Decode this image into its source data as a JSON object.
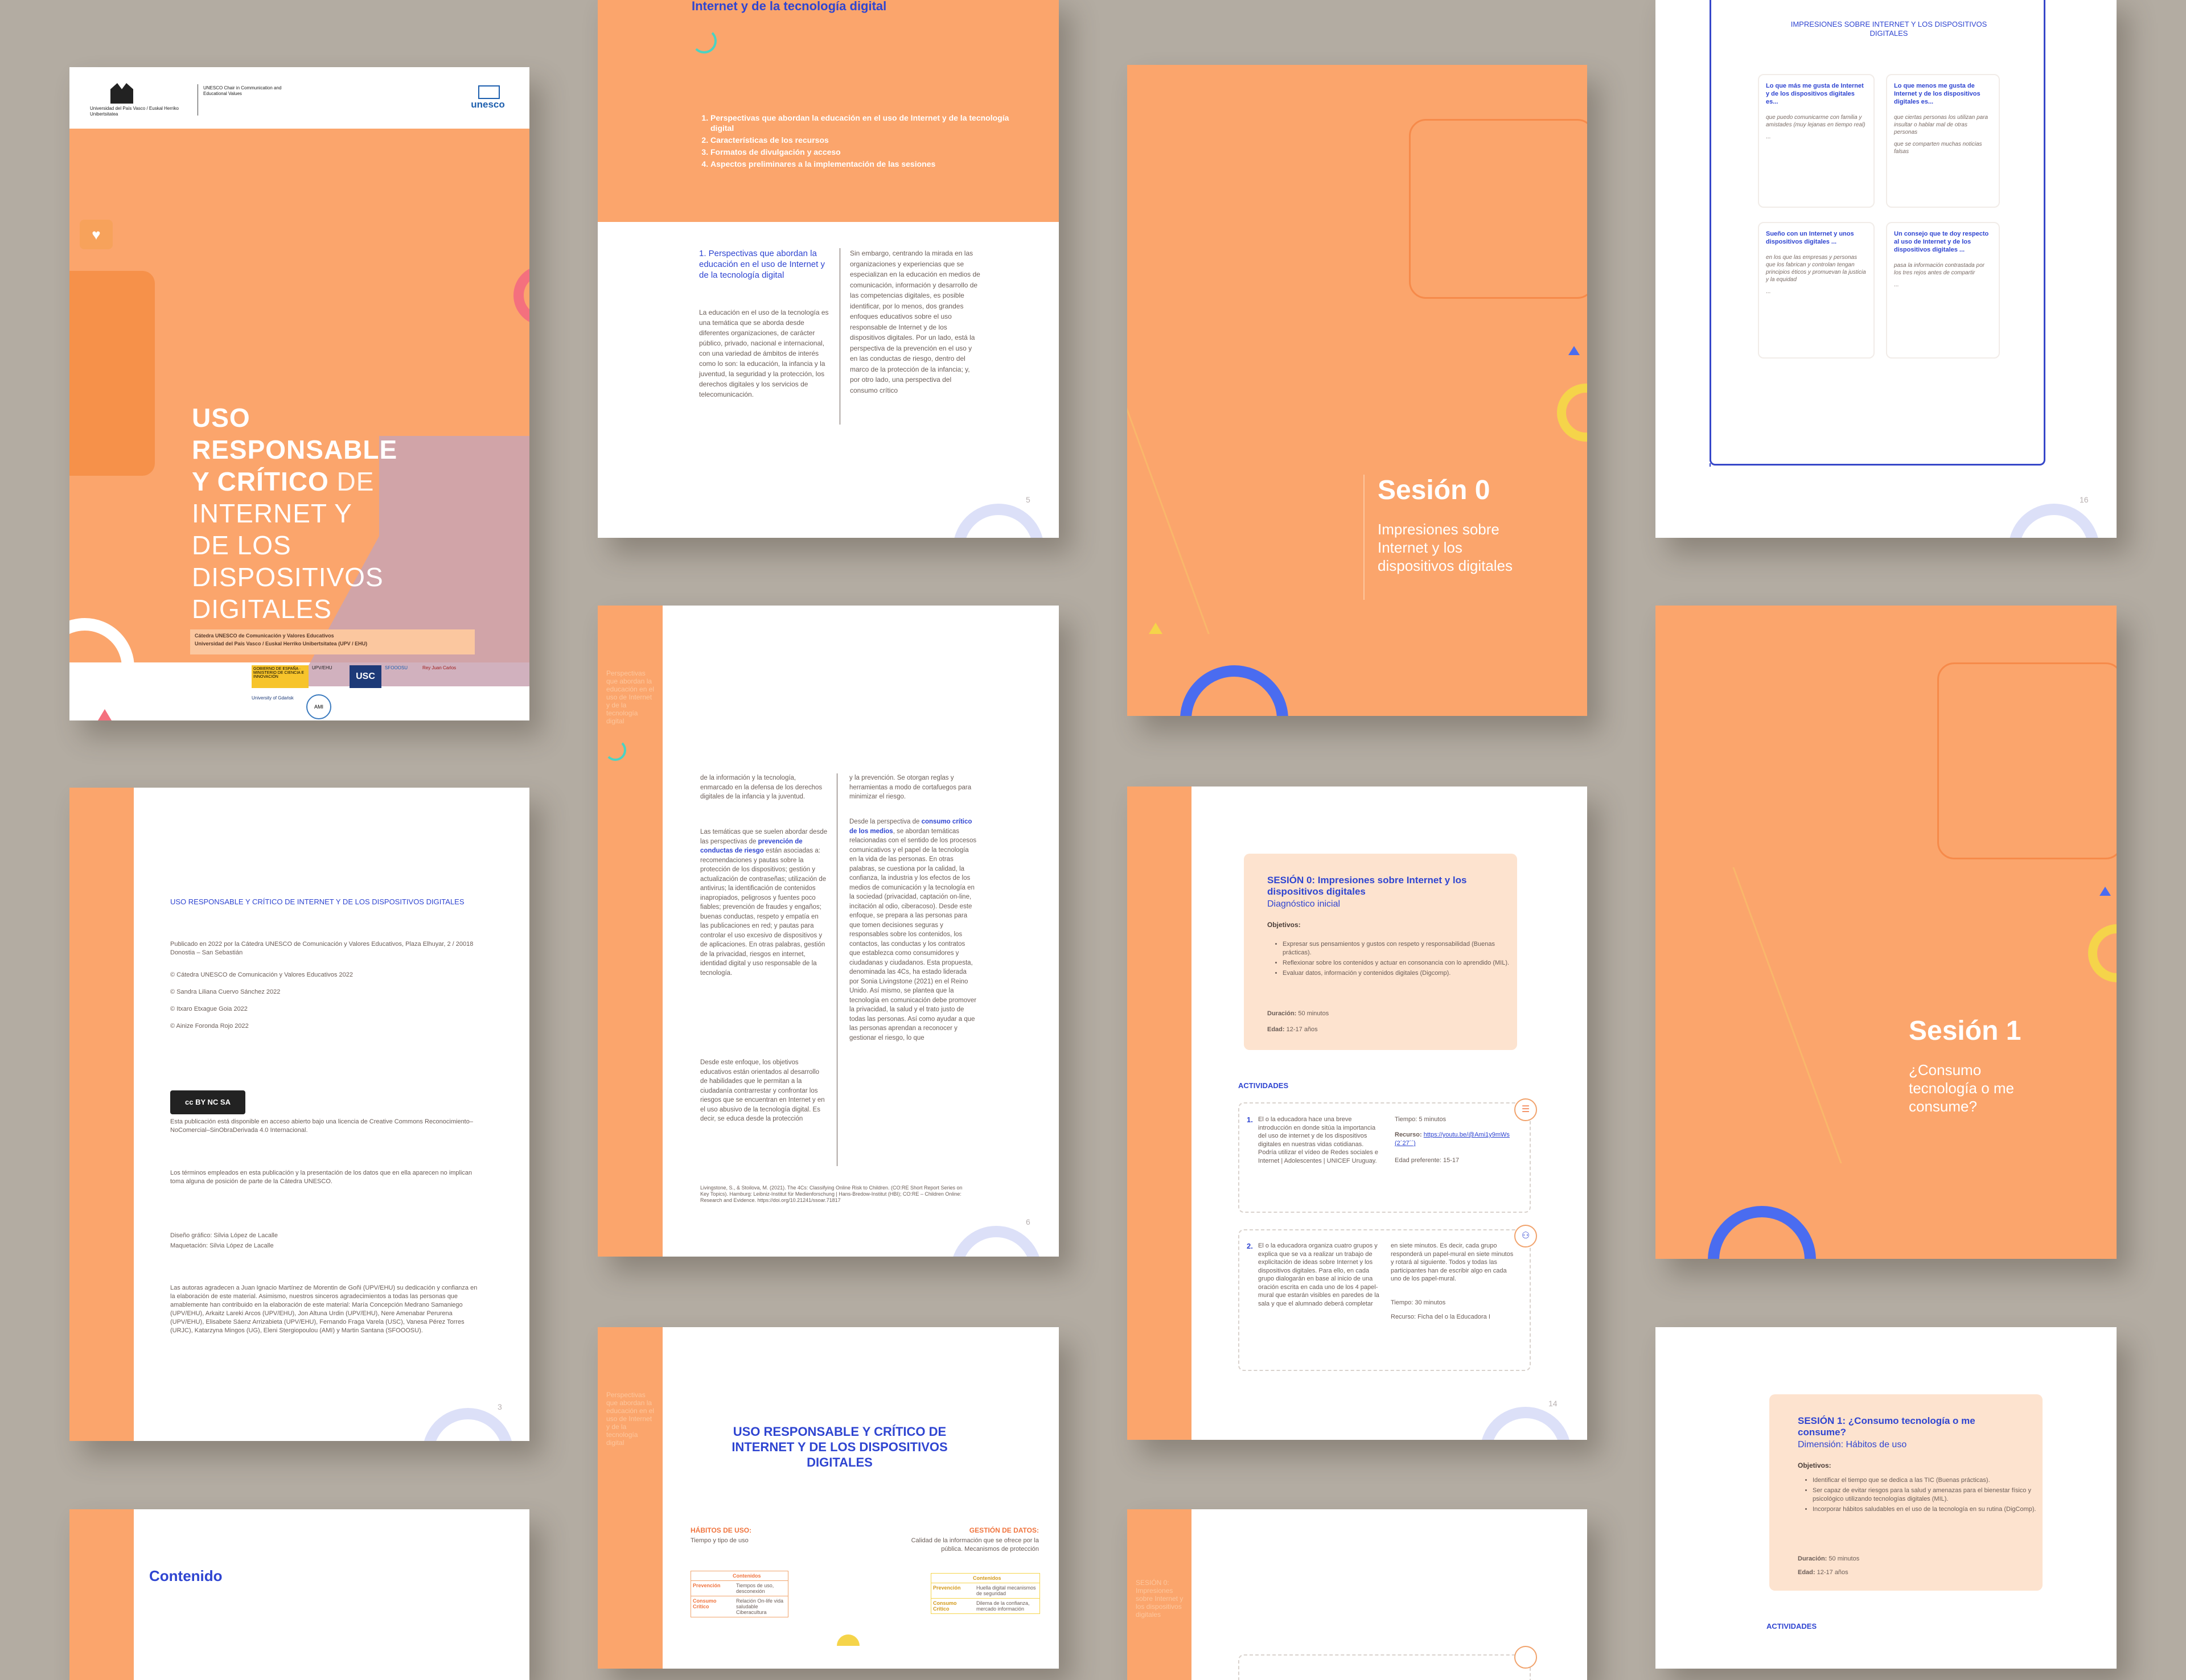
{
  "palette": {
    "orange": "#fba56c",
    "blue": "#2f45d1",
    "cream": "#fde3cf",
    "yellow": "#f5d44a",
    "pink": "#f4707e",
    "grey_bg": "#b3aca2"
  },
  "cover": {
    "header_university": "Universidad del País Vasco / Euskal Herriko Unibertsitatea",
    "header_chair": "UNESCO Chair in Communication and Educational Values",
    "unesco_logo": "unesco",
    "title_line1": "USO",
    "title_line2": "RESPONSABLE",
    "title_line3_bold": "Y CRÍTICO",
    "title_line3_light": "DE",
    "title_line4": "INTERNET Y",
    "title_line5": "DE LOS",
    "title_line6": "DISPOSITIVOS",
    "title_line7": "DIGITALES",
    "subtitle1": "Cátedra UNESCO de Comunicación y Valores Educativos",
    "subtitle2": "Universidad del País Vasco / Euskal Herriko Unibertsitatea (UPV / EHU)",
    "footer_logos": [
      "GOBIERNO DE ESPAÑA · MINISTERIO DE CIENCIA E INNOVACIÓN",
      "UPV/EHU",
      "USC",
      "SFOOOSU",
      "Rey Juan Carlos",
      "University of Gdańsk",
      "AMI"
    ]
  },
  "contents": {
    "heading_top": "Internet y de la tecnología digital",
    "items": [
      "Perspectivas que abordan la educación en el uso de Internet y de la tecnología digital",
      "Características de los recursos",
      "Formatos de divulgación y acceso",
      "Aspectos preliminares a la implementación de las sesiones"
    ],
    "section_title": "1. Perspectivas que abordan la educación en el uso de Internet y de la tecnología digital",
    "col1": "La educación en el uso de la tecnología es una temática que se aborda desde diferentes organizaciones, de carácter público, privado, nacional e internacional, con una variedad de ámbitos de interés como lo son: la educación, la infancia y la juventud, la seguridad y la protección, los derechos digitales y los servicios de telecomunicación.",
    "col2": "Sin embargo, centrando la mirada en las organizaciones y experiencias que se especializan en la educación en medios de comunicación, información y desarrollo de las competencias digitales, es posible identificar, por lo menos, dos grandes enfoques educativos sobre el uso responsable de Internet y de los dispositivos digitales. Por un lado, está la perspectiva de la prevención en el uso y en las conductas de riesgo, dentro del marco de la protección de la infancia; y, por otro lado, una perspectiva del consumo crítico",
    "page_number": "5"
  },
  "session0_cover": {
    "title": "Sesión 0",
    "subtitle": "Impresiones sobre Internet y los dispositivos digitales"
  },
  "impressions": {
    "heading": "IMPRESIONES SOBRE INTERNET Y LOS DISPOSITIVOS DIGITALES",
    "cards": [
      {
        "title": "Lo que más me gusta de Internet y de los dispositivos digitales es...",
        "item1": "que puedo comunicarme con familia y amistades (muy lejanas en tiempo real)",
        "item2": "..."
      },
      {
        "title": "Lo que menos me gusta de Internet y de los dispositivos digitales es...",
        "item1": "que ciertas personas los utilizan para insultar o hablar mal de otras personas",
        "item2": "que se comparten muchas noticias falsas"
      },
      {
        "title": "Sueño con un Internet y unos dispositivos digitales ...",
        "item1": "en los que las empresas y personas que los fabrican y controlan tengan principios éticos y promuevan la justicia y la equidad",
        "item2": "..."
      },
      {
        "title": "Un consejo que te doy respecto al uso de Internet y de los dispositivos digitales ...",
        "item1": "pasa la información contrastada por los tres rejos antes de compartir",
        "item2": "..."
      }
    ],
    "page_number": "16"
  },
  "credits": {
    "title": "USO RESPONSABLE Y CRÍTICO DE INTERNET Y DE LOS DISPOSITIVOS DIGITALES",
    "published": "Publicado en 2022 por la Cátedra UNESCO de Comunicación y Valores Educativos, Plaza Elhuyar, 2 / 20018 Donostia – San Sebastián",
    "c1": "© Cátedra UNESCO de Comunicación y Valores Educativos 2022",
    "c2": "© Sandra Liliana Cuervo Sánchez 2022",
    "c3": "© Itxaro Etxague Goia 2022",
    "c4": "© Ainize Foronda Rojo 2022",
    "cc_badge": "cc BY NC SA",
    "license": "Esta publicación está disponible en acceso abierto bajo una licencia de Creative Commons Reconocimiento–NoComercial–SinObraDerivada 4.0 Internacional.",
    "terms": "Los términos empleados en esta publicación y la presentación de los datos que en ella aparecen no implican toma alguna de posición de parte de la Cátedra UNESCO.",
    "design1": "Diseño gráfico: Silvia López de Lacalle",
    "design2": "Maquetación: Silvia López de Lacalle",
    "thanks": "Las autoras agradecen a Juan Ignacio Martínez de Morentin de Goñi (UPV/EHU) su dedicación y confianza en la elaboración de este material. Asimismo, nuestros sinceros agradecimientos a todas las personas que amablemente han contribuido en la elaboración de este material: María Concepción Medrano Samaniego (UPV/EHU), Arkaitz Lareki Arcos (UPV/EHU), Jon Altuna Urdin (UPV/EHU), Nere Amenabar Perurena (UPV/EHU), Elisabete Sáenz Arrizabieta (UPV/EHU), Fernando Fraga Varela (USC), Vanesa Pérez Torres (URJC), Katarzyna Mingos (UG), Eleni Stergiopoulou (AMI) y Martin Santana (SFOOOSU).",
    "page_number": "3"
  },
  "page6": {
    "sidebar": "Perspectivas que abordan la educación en el uso de Internet y de la tecnología digital",
    "col1a": "de la información y la tecnología, enmarcado en la defensa de los derechos digitales de la infancia y la juventud.",
    "col1b_pre": "Las temáticas que se suelen abordar desde las perspectivas de",
    "col1b_blue": "prevención de conductas de riesgo",
    "col1b_post": "están asociadas a: recomendaciones y pautas sobre la protección de los dispositivos; gestión y actualización de contraseñas; utilización de antivirus; la identificación de contenidos inapropiados, peligrosos y fuentes poco fiables; prevención de fraudes y engaños; buenas conductas, respeto y empatía en las publicaciones en red; y pautas para controlar el uso excesivo de dispositivos y de aplicaciones. En otras palabras, gestión de la privacidad, riesgos en internet, identidad digital y uso responsable de la tecnología.",
    "col1c": "Desde este enfoque, los objetivos educativos están orientados al desarrollo de habilidades que le permitan a la ciudadanía contrarrestar y confrontar los riesgos que se encuentran en Internet y en el uso abusivo de la tecnología digital. Es decir, se educa desde la protección",
    "col2a": "y la prevención. Se otorgan reglas y herramientas a modo de cortafuegos para minimizar el riesgo.",
    "col2b_pre": "Desde la perspectiva de",
    "col2b_blue": "consumo crítico de los medios",
    "col2b_post": ", se abordan temáticas relacionadas con el sentido de los procesos comunicativos y el papel de la tecnología en la vida de las personas. En otras palabras, se cuestiona por la calidad, la confianza, la industria y los efectos de los medios de comunicación y la tecnología en la sociedad (privacidad, captación on-line, incitación al odio, ciberacoso). Desde este enfoque, se prepara a las personas para que tomen decisiones seguras y responsables sobre los contenidos, los contactos, las conductas y los contratos que establezca como consumidores y ciudadanas y ciudadanos. Esta propuesta, denominada las 4Cs, ha estado liderada por Sonia Livingstone (2021) en el Reino Unido. Así mismo, se plantea que la tecnología en comunicación debe promover la privacidad, la salud y el trato justo de todas las personas. Así como ayudar a que las personas aprendan a reconocer y gestionar el riesgo, lo que",
    "footnote": "Livingstone, S., & Stoilova, M. (2021). The 4Cs: Classifying Online Risk to Children. (CO:RE Short Report Series on Key Topics). Hamburg: Leibniz-Institut für Medienforschung | Hans-Bredow-Institut (HBI); CO:RE – Children Online: Research and Evidence. https://doi.org/10.21241/ssoar.71817",
    "page_number": "6"
  },
  "session0_detail": {
    "title": "SESIÓN 0: Impresiones sobre Internet y los dispositivos digitales",
    "subtitle": "Diagnóstico inicial",
    "objectives_label": "Objetivos:",
    "objectives": [
      "Expresar sus pensamientos y gustos con respeto y responsabilidad (Buenas prácticas).",
      "Reflexionar sobre los contenidos y actuar en consonancia con lo aprendido (MIL).",
      "Evaluar datos, información y contenidos digitales (Digcomp)."
    ],
    "duration_label": "Duración:",
    "duration": "50 minutos",
    "age_label": "Edad:",
    "age": "12-17 años",
    "activities_label": "ACTIVIDADES",
    "act1_num": "1.",
    "act1": "El o la educadora hace una breve introducción en donde sitúa la importancia del uso de internet y de los dispositivos digitales en nuestras vidas cotidianas. Podría utilizar el vídeo de Redes sociales e Internet | Adolescentes | UNICEF Uruguay.",
    "act1_time": "Tiempo: 5 minutos",
    "act1_res_label": "Recurso:",
    "act1_res": "https://youtu.be/@Ami1y9mWs (2´27´´)",
    "act1_age": "Edad preferente: 15-17",
    "act2_num": "2.",
    "act2": "El o la educadora organiza cuatro grupos y explica que se va a realizar un trabajo de explicitación de ideas sobre Internet y los dispositivos digitales. Para ello, en cada grupo dialogarán en base al inicio de una oración escrita en cada uno de los 4 papel-mural que estarán visibles en paredes de la sala y que el alumnado deberá completar",
    "act2_b": "en siete minutos. Es decir, cada grupo responderá un papel-mural en siete minutos y rotará al siguiente. Todos y todas las participantes han de escribir algo en cada uno de los papel-mural.",
    "act2_time": "Tiempo: 30 minutos",
    "act2_res": "Recurso: Ficha del o la Educadora I",
    "page_number": "14"
  },
  "session1_cover": {
    "title": "Sesión 1",
    "subtitle": "¿Consumo tecnología o me consume?"
  },
  "usage_page": {
    "sidebar": "Perspectivas que abordan la educación en el uso de Internet y de la tecnología digital",
    "title": "USO RESPONSABLE Y CRÍTICO DE INTERNET Y DE LOS DISPOSITIVOS DIGITALES",
    "left_title": "HÁBITOS DE USO:",
    "left_sub": "Tiempo y tipo de uso",
    "right_title": "GESTIÓN DE DATOS:",
    "right_sub": "Calidad de la información que se ofrece por la pública. Mecanismos de protección",
    "table_header": "Contenidos",
    "left_rows": [
      [
        "Prevención",
        "Tiempos de uso, desconexión"
      ],
      [
        "Consumo Crítico",
        "Relación On-life vida saludable Ciberacultura"
      ]
    ],
    "right_rows": [
      [
        "Prevención",
        "Huella digital mecanismos de seguridad"
      ],
      [
        "Consumo Crítico",
        "Dilema de la confianza, mercado información"
      ]
    ]
  },
  "session1_detail": {
    "title": "SESIÓN 1: ¿Consumo tecnología o me consume?",
    "subtitle": "Dimensión: Hábitos de uso",
    "objectives_label": "Objetivos:",
    "objectives": [
      "Identificar el tiempo que se dedica a las TIC (Buenas prácticas).",
      "Ser capaz de evitar riesgos para la salud y amenazas para el bienestar físico y psicológico utilizando tecnologías digitales (MIL).",
      "Incorporar hábitos saludables en el uso de la tecnología en su rutina (DigComp)."
    ],
    "duration_label": "Duración:",
    "duration": "50 minutos",
    "age_label": "Edad:",
    "age": "12-17 años",
    "activities_label": "ACTIVIDADES"
  },
  "index_page": {
    "title": "Contenido"
  },
  "bottom_page": {
    "sidebar": "SESIÓN 0: Impresiones sobre Internet y los dispositivos digitales"
  }
}
